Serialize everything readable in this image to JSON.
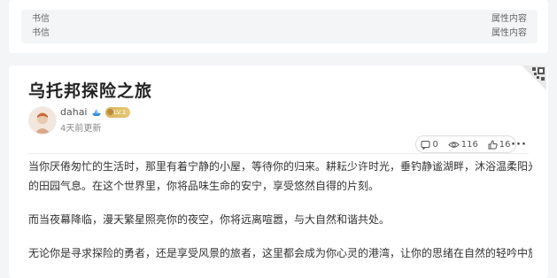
{
  "info_box": {
    "rows": [
      {
        "key": "书信",
        "value": "属性内容"
      },
      {
        "key": "书信",
        "value": "属性内容"
      }
    ]
  },
  "article": {
    "title": "乌托邦探险之旅",
    "author": {
      "name": "dahai",
      "level_badge": "LV.1"
    },
    "time": "4天前更新",
    "stats": {
      "comments": "0",
      "views": "116",
      "likes": "16"
    },
    "paragraphs": [
      "当你厌倦匆忙的生活时，那里有着宁静的小屋，等待你的归来。耕耘少许时光，垂钓静谧湖畔，沐浴温柔阳光下",
      "的田园气息。在这个世界里，你将品味生命的安宁，享受悠然自得的片刻。",
      "而当夜幕降临，漫天繁星照亮你的夜空，你将远离喧嚣，与大自然和谐共处。",
      "无论你是寻求探险的勇者，还是享受风景的旅者，这里都会成为你心灵的港湾，让你的思绪在自然的轻吟中放"
    ]
  },
  "colors": {
    "background": "#f4f5f7",
    "card": "#ffffff",
    "badge": "#d8b25a"
  }
}
